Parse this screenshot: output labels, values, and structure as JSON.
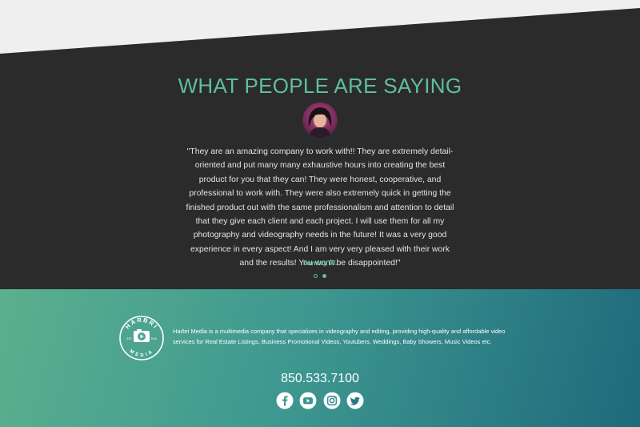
{
  "testimonials": {
    "title": "WHAT PEOPLE ARE SAYING",
    "quote": "\"They are an amazing company to work with!! They are extremely detail-oriented and put many many exhaustive hours into creating the best product for you that they can! They were honest, cooperative, and professional to work with. They were also extremely quick in getting the finished product out with the same professionalism and attention to detail that they give each client and each project. I will use them for all my photography and videography needs in the future! It was a very good experience in every aspect! And I am very very pleased with their work and the results! You won't be disappointed!\"",
    "author": "Sandey W.",
    "slider": {
      "count": 2,
      "active_index": 1
    }
  },
  "footer": {
    "logo": {
      "top_text": "HARBRI",
      "bottom_text": "MEDIA",
      "left_text": "EST.",
      "right_text": "2018"
    },
    "about": "Harbri Media is a multimedia company that specializes in videography and editing, providing high-quality and affordable video services for Real Estate Listings, Business Promotional Videos, Youtubers, Weddings, Baby Showers, Music Videos etc.",
    "phone": "850.533.7100",
    "social": [
      "facebook-icon",
      "youtube-icon",
      "instagram-icon",
      "twitter-icon"
    ]
  },
  "colors": {
    "accent": "#5fbf9a",
    "dark_bg": "#2b2b2b",
    "light_bg": "#efefef",
    "footer_gradient_start": "#5bb08e",
    "footer_gradient_end": "#1e6a7c"
  }
}
